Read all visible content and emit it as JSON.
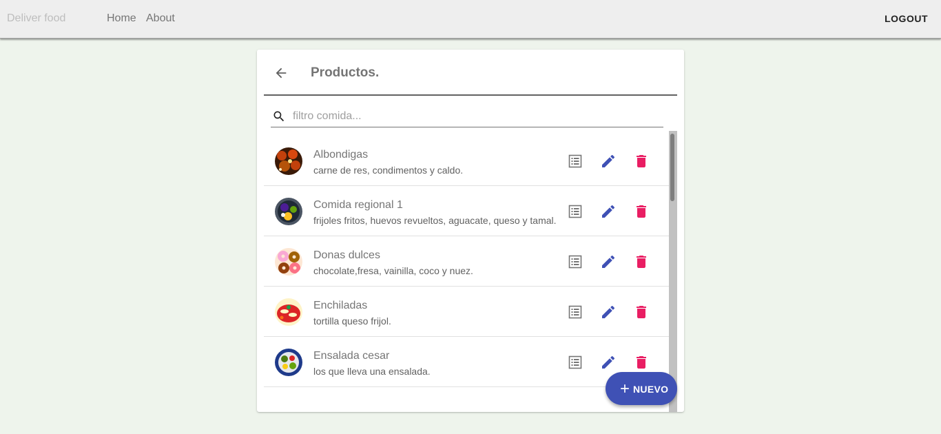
{
  "app": {
    "brand": "Deliver food",
    "nav": [
      {
        "label": "Home"
      },
      {
        "label": "About"
      }
    ],
    "logout_label": "LOGOUT"
  },
  "card": {
    "title": "Productos.",
    "search": {
      "placeholder": "filtro comida...",
      "value": ""
    }
  },
  "products": [
    {
      "name": "Albondigas",
      "description": "carne de res, condimentos y caldo."
    },
    {
      "name": "Comida regional 1",
      "description": "frijoles fritos, huevos revueltos, aguacate, queso y tamal."
    },
    {
      "name": "Donas dulces",
      "description": "chocolate,fresa, vainilla, coco y nuez."
    },
    {
      "name": "Enchiladas",
      "description": "tortilla queso frijol."
    },
    {
      "name": "Ensalada cesar",
      "description": "los que lleva una ensalada."
    }
  ],
  "fab": {
    "label": "NUEVO"
  },
  "colors": {
    "primary": "#3f51b5",
    "delete": "#e91e63",
    "detail_icon": "#757575",
    "page_bg": "#eef4ec"
  },
  "icons": {
    "back": "arrow-back-icon",
    "search": "search-icon",
    "detail": "list-detail-icon",
    "edit": "pencil-icon",
    "delete": "trash-icon",
    "add": "plus-icon"
  }
}
